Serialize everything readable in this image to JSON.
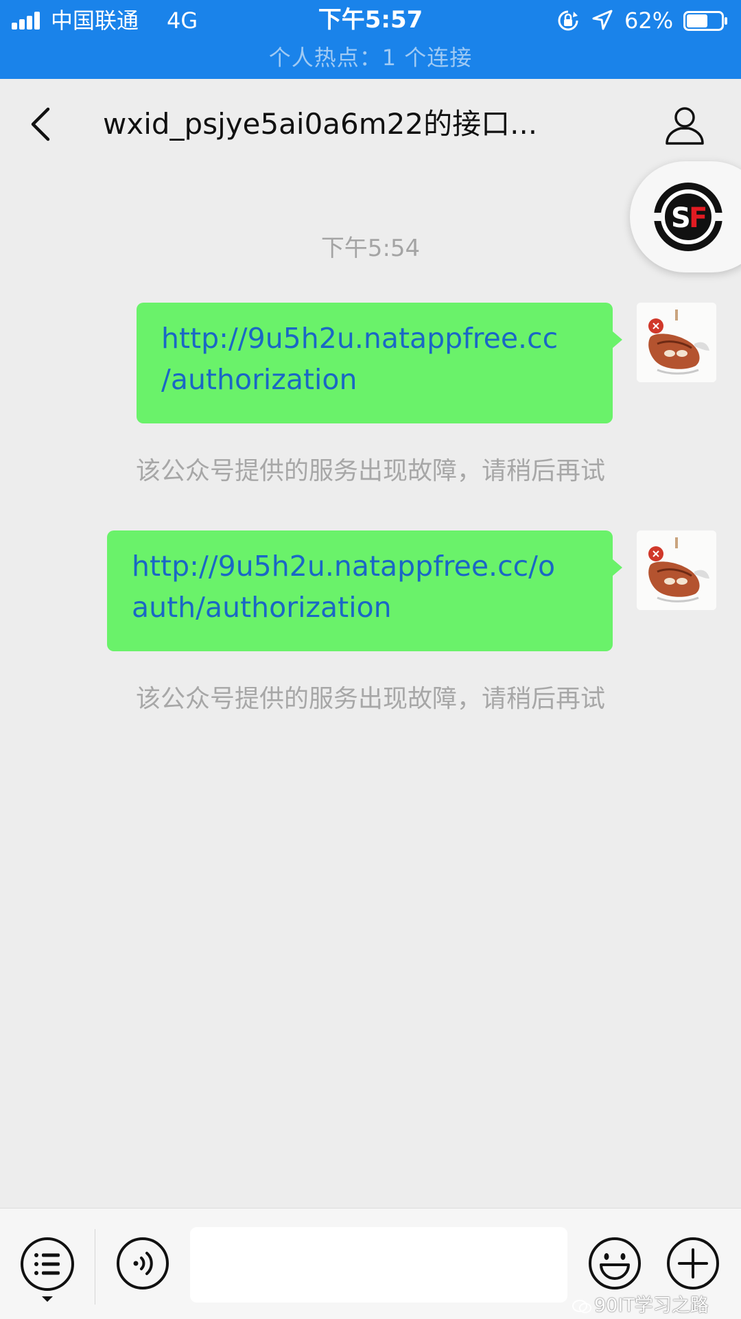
{
  "status_bar": {
    "carrier": "中国联通",
    "network": "4G",
    "time": "下午5:57",
    "battery_percent": "62%",
    "battery_level": 0.62,
    "hotspot_text": "个人热点：1 个连接",
    "background_color": "#1a83ea",
    "icons": [
      "signal-bars-icon",
      "rotation-lock-icon",
      "location-arrow-icon",
      "battery-icon"
    ]
  },
  "nav": {
    "title": "wxid_psjye5ai0a6m22的接口...",
    "icons": [
      "back-chevron-icon",
      "profile-icon"
    ]
  },
  "floating_bubble": {
    "logo_text": "SF",
    "accent_color": "#e21b22"
  },
  "chat": {
    "timestamp": "下午5:54",
    "messages": [
      {
        "lines": [
          "http://9u5h2u.natappfree.cc",
          "/authorization"
        ],
        "system_reply": "该公众号提供的服务出现故障，请稍后再试"
      },
      {
        "lines": [
          "http://9u5h2u.natappfree.cc/o",
          "auth/authorization"
        ],
        "system_reply": "该公众号提供的服务出现故障，请稍后再试"
      }
    ],
    "bubble_color": "#6af26a",
    "link_color": "#1a67c5"
  },
  "toolbar": {
    "input_value": "",
    "icons": [
      "menu-list-icon",
      "voice-icon",
      "emoji-icon",
      "plus-icon"
    ]
  },
  "watermark": {
    "text": "90IT学习之路"
  }
}
